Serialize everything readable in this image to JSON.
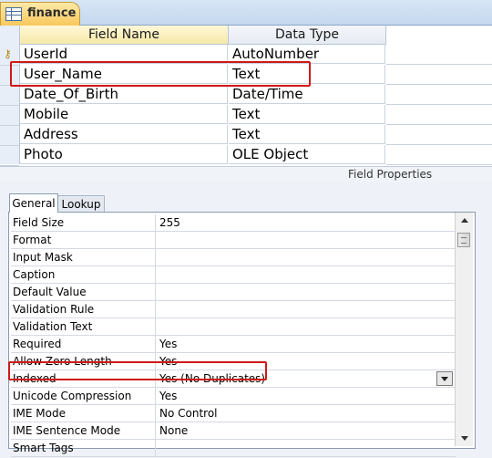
{
  "document_tab": {
    "label": "finance",
    "icon": "table-icon"
  },
  "grid": {
    "headers": {
      "field_name": "Field Name",
      "data_type": "Data Type"
    },
    "rows": [
      {
        "name": "UserId",
        "type": "AutoNumber",
        "is_key": true
      },
      {
        "name": "User_Name",
        "type": "Text",
        "is_key": false
      },
      {
        "name": "Date_Of_Birth",
        "type": "Date/Time",
        "is_key": false
      },
      {
        "name": "Mobile",
        "type": "Text",
        "is_key": false
      },
      {
        "name": "Address",
        "type": "Text",
        "is_key": false
      },
      {
        "name": "Photo",
        "type": "OLE Object",
        "is_key": false
      }
    ]
  },
  "field_properties": {
    "label": "Field Properties",
    "tabs": {
      "general": "General",
      "lookup": "Lookup"
    },
    "properties": [
      {
        "name": "Field Size",
        "value": "255"
      },
      {
        "name": "Format",
        "value": ""
      },
      {
        "name": "Input Mask",
        "value": ""
      },
      {
        "name": "Caption",
        "value": ""
      },
      {
        "name": "Default Value",
        "value": ""
      },
      {
        "name": "Validation Rule",
        "value": ""
      },
      {
        "name": "Validation Text",
        "value": ""
      },
      {
        "name": "Required",
        "value": "Yes"
      },
      {
        "name": "Allow Zero Length",
        "value": "Yes"
      },
      {
        "name": "Indexed",
        "value": "Yes (No Duplicates)"
      },
      {
        "name": "Unicode Compression",
        "value": "Yes"
      },
      {
        "name": "IME Mode",
        "value": "No Control"
      },
      {
        "name": "IME Sentence Mode",
        "value": "None"
      },
      {
        "name": "Smart Tags",
        "value": ""
      }
    ]
  },
  "colors": {
    "highlight": "#d01818",
    "tab_active": "#f8c85c",
    "header_bg": "#f6e8a8"
  }
}
